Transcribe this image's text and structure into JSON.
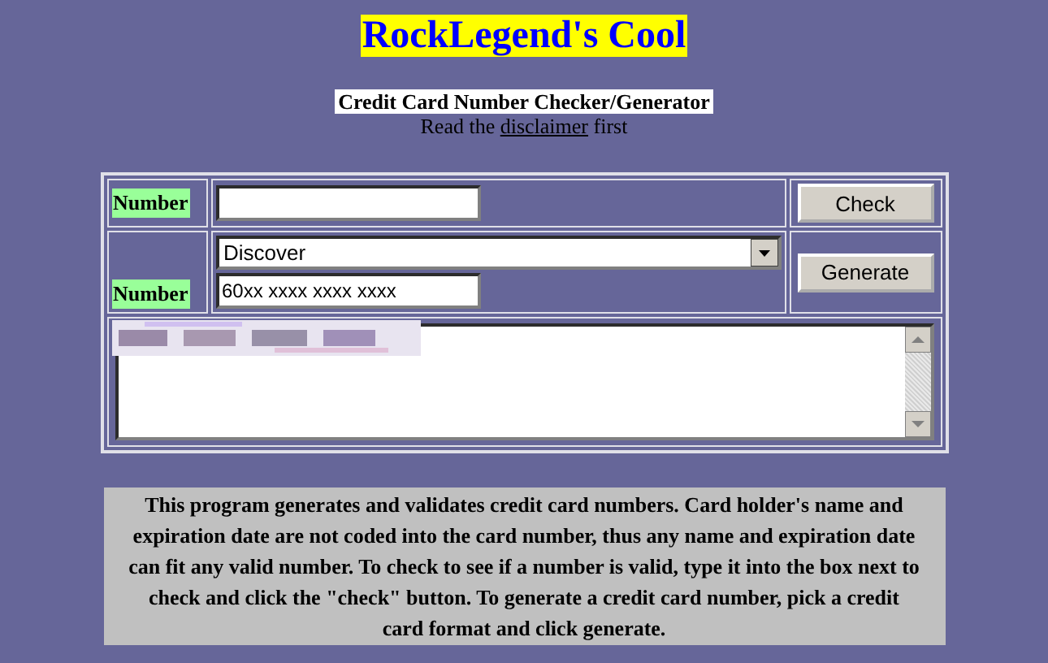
{
  "title": "RockLegend's Cool",
  "subtitle": "Credit Card Number Checker/Generator",
  "notice": {
    "before": "Read the ",
    "link": "disclaimer",
    "after": " first"
  },
  "check_row": {
    "label": "Number",
    "button": "Check"
  },
  "generate_row": {
    "label": "Number",
    "card_type": "Discover",
    "format": "60xx xxxx xxxx xxxx",
    "button": "Generate"
  },
  "description": "This program generates and validates credit card numbers. Card holder's name and expiration date are not coded into the card number, thus any name and expiration date can fit any valid number. To check to see if a number is valid, type it into the box next to check and click the \"check\" button. To generate a credit card number, pick a credit card format and click generate."
}
